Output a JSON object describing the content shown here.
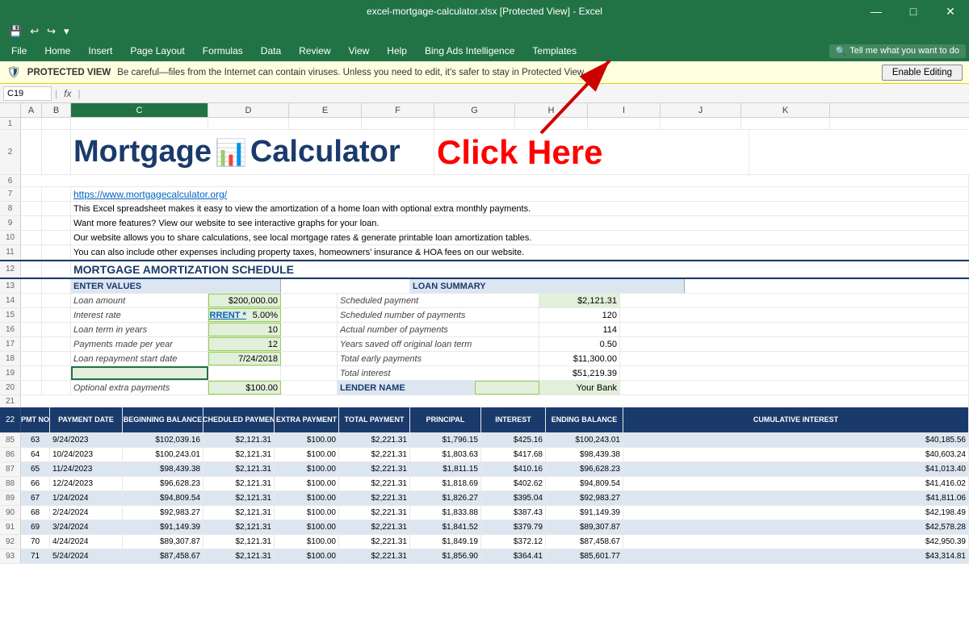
{
  "titleBar": {
    "text": "excel-mortgage-calculator.xlsx [Protected View] - Excel"
  },
  "quickAccess": {
    "buttons": [
      "💾",
      "↩",
      "↪",
      "▾"
    ]
  },
  "menuBar": {
    "items": [
      "File",
      "Home",
      "Insert",
      "Page Layout",
      "Formulas",
      "Data",
      "Review",
      "View",
      "Help",
      "Bing Ads Intelligence",
      "Templates"
    ]
  },
  "searchBar": {
    "placeholder": "Tell me what you want to do"
  },
  "protectedView": {
    "label": "PROTECTED VIEW",
    "message": "Be careful—files from the Internet can contain viruses. Unless you need to edit, it's safer to stay in Protected View.",
    "buttonLabel": "Enable Editing"
  },
  "formulaBar": {
    "cellRef": "C19",
    "fx": "fx"
  },
  "columns": [
    "A",
    "B",
    "C",
    "D",
    "E",
    "F",
    "G",
    "H",
    "I",
    "J",
    "K"
  ],
  "sheet": {
    "title": "Mortgage",
    "calcIcon": "⊞",
    "titleRest": "Calculator",
    "clickHere": "Click Here",
    "link": "https://www.mortgagecalculator.org/",
    "desc1": "This Excel spreadsheet makes it easy to view the amortization of a home loan with optional extra monthly payments.",
    "desc2": "Want more features? View our website to see interactive graphs for your loan.",
    "desc3": "Our website allows you to share calculations, see local mortgage rates & generate printable loan amortization tables.",
    "desc4": "You can also include other expenses including property taxes, homeowners' insurance & HOA fees on our website.",
    "sectionHeader": "MORTGAGE AMORTIZATION SCHEDULE",
    "enterValues": "ENTER VALUES",
    "loanSummary": "LOAN SUMMARY",
    "fields": {
      "loanAmount": "Loan amount",
      "interestRate": "Interest rate",
      "loanTerm": "Loan term in years",
      "paymentsPerYear": "Payments made per year",
      "startDate": "Loan repayment start date",
      "extraPayments": "Optional extra payments"
    },
    "values": {
      "loanAmount": "$200,000.00",
      "interestRate": "5.00%",
      "loanTerm": "10",
      "paymentsPerYear": "12",
      "startDate": "7/24/2018",
      "extraPayments": "$100.00"
    },
    "seeCurrent": "* SEE CURRENT *",
    "summaryFields": {
      "scheduledPayment": "Scheduled payment",
      "scheduledPayments": "Scheduled number of payments",
      "actualPayments": "Actual number of payments",
      "yearsSaved": "Years saved off original loan term",
      "totalEarly": "Total early payments",
      "totalInterest": "Total interest",
      "lenderName": "LENDER NAME"
    },
    "summaryValues": {
      "scheduledPayment": "$2,121.31",
      "scheduledPayments": "120",
      "actualPayments": "114",
      "yearsSaved": "0.50",
      "totalEarly": "$11,300.00",
      "totalInterest": "$51,219.39",
      "lenderName": "Your Bank"
    },
    "tableHeaders": {
      "pmtNo": "PMT NO",
      "paymentDate": "PAYMENT DATE",
      "beginBalance": "BEGINNING BALANCE",
      "scheduledPayment": "SCHEDULED PAYMENT",
      "extraPayment": "EXTRA PAYMENT",
      "totalPayment": "TOTAL PAYMENT",
      "principal": "PRINCIPAL",
      "interest": "INTEREST",
      "endingBalance": "ENDING BALANCE",
      "cumulativeInterest": "CUMULATIVE INTEREST"
    },
    "tableData": [
      {
        "row": 85,
        "pmt": 63,
        "date": "9/24/2023",
        "beginBal": "$102,039.16",
        "schedPay": "$2,121.31",
        "extra": "$100.00",
        "totalPay": "$2,221.31",
        "principal": "$1,796.15",
        "interest": "$425.16",
        "endBal": "$100,243.01",
        "cumInt": "$40,185.56"
      },
      {
        "row": 86,
        "pmt": 64,
        "date": "10/24/2023",
        "beginBal": "$100,243.01",
        "schedPay": "$2,121.31",
        "extra": "$100.00",
        "totalPay": "$2,221.31",
        "principal": "$1,803.63",
        "interest": "$417.68",
        "endBal": "$98,439.38",
        "cumInt": "$40,603.24"
      },
      {
        "row": 87,
        "pmt": 65,
        "date": "11/24/2023",
        "beginBal": "$98,439.38",
        "schedPay": "$2,121.31",
        "extra": "$100.00",
        "totalPay": "$2,221.31",
        "principal": "$1,811.15",
        "interest": "$410.16",
        "endBal": "$96,628.23",
        "cumInt": "$41,013.40"
      },
      {
        "row": 88,
        "pmt": 66,
        "date": "12/24/2023",
        "beginBal": "$96,628.23",
        "schedPay": "$2,121.31",
        "extra": "$100.00",
        "totalPay": "$2,221.31",
        "principal": "$1,818.69",
        "interest": "$402.62",
        "endBal": "$94,809.54",
        "cumInt": "$41,416.02"
      },
      {
        "row": 89,
        "pmt": 67,
        "date": "1/24/2024",
        "beginBal": "$94,809.54",
        "schedPay": "$2,121.31",
        "extra": "$100.00",
        "totalPay": "$2,221.31",
        "principal": "$1,826.27",
        "interest": "$395.04",
        "endBal": "$92,983.27",
        "cumInt": "$41,811.06"
      },
      {
        "row": 90,
        "pmt": 68,
        "date": "2/24/2024",
        "beginBal": "$92,983.27",
        "schedPay": "$2,121.31",
        "extra": "$100.00",
        "totalPay": "$2,221.31",
        "principal": "$1,833.88",
        "interest": "$387.43",
        "endBal": "$91,149.39",
        "cumInt": "$42,198.49"
      },
      {
        "row": 91,
        "pmt": 69,
        "date": "3/24/2024",
        "beginBal": "$91,149.39",
        "schedPay": "$2,121.31",
        "extra": "$100.00",
        "totalPay": "$2,221.31",
        "principal": "$1,841.52",
        "interest": "$379.79",
        "endBal": "$89,307.87",
        "cumInt": "$42,578.28"
      },
      {
        "row": 92,
        "pmt": 70,
        "date": "4/24/2024",
        "beginBal": "$89,307.87",
        "schedPay": "$2,121.31",
        "extra": "$100.00",
        "totalPay": "$2,221.31",
        "principal": "$1,849.19",
        "interest": "$372.12",
        "endBal": "$87,458.67",
        "cumInt": "$42,950.39"
      },
      {
        "row": 93,
        "pmt": 71,
        "date": "5/24/2024",
        "beginBal": "$87,458.67",
        "schedPay": "$2,121.31",
        "extra": "$100.00",
        "totalPay": "$2,221.31",
        "principal": "$1,856.90",
        "interest": "$364.41",
        "endBal": "$85,601.77",
        "cumInt": "$43,314.81"
      }
    ]
  }
}
